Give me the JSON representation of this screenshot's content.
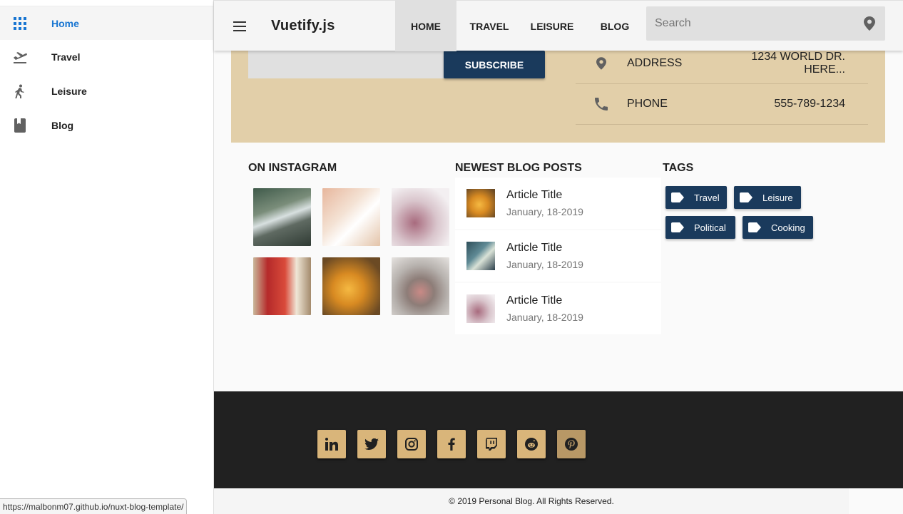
{
  "sidebar": {
    "items": [
      {
        "label": "Home",
        "icon": "apps-grid-icon",
        "active": true
      },
      {
        "label": "Travel",
        "icon": "airplane-takeoff-icon"
      },
      {
        "label": "Leisure",
        "icon": "hiker-icon"
      },
      {
        "label": "Blog",
        "icon": "book-icon"
      }
    ]
  },
  "toolbar": {
    "brand": "Vuetify.js",
    "tabs": [
      "HOME",
      "TRAVEL",
      "LEISURE",
      "BLOG"
    ],
    "active_tab": "HOME",
    "search_placeholder": "Search",
    "search_value": ""
  },
  "contact": {
    "subscribe_label": "SUBSCRIBE",
    "address_label": "ADDRESS",
    "address_value": "1234 WORLD DR. HERE...",
    "phone_label": "PHONE",
    "phone_value": "555-789-1234"
  },
  "instagram": {
    "title": "ON INSTAGRAM",
    "photos": [
      {
        "subject": "waterfall-rocks"
      },
      {
        "subject": "desk-phone"
      },
      {
        "subject": "pink-blossoms"
      },
      {
        "subject": "red-mug"
      },
      {
        "subject": "orange-spiky-plant"
      },
      {
        "subject": "cat-nose"
      }
    ]
  },
  "blog": {
    "title": "NEWEST BLOG POSTS",
    "posts": [
      {
        "title": "Article Title",
        "date": "January, 18-2019"
      },
      {
        "title": "Article Title",
        "date": "January, 18-2019"
      },
      {
        "title": "Article Title",
        "date": "January, 18-2019"
      }
    ]
  },
  "tags": {
    "title": "TAGS",
    "items": [
      "Travel",
      "Leisure",
      "Political",
      "Cooking"
    ]
  },
  "footer": {
    "social": [
      "linkedin-icon",
      "twitter-icon",
      "instagram-icon",
      "facebook-icon",
      "twitch-icon",
      "reddit-icon",
      "pinterest-icon"
    ],
    "copyright": "© 2019 Personal Blog. All Rights Reserved."
  },
  "status_bar": {
    "url": "https://malbonm07.github.io/nuxt-blog-template/"
  },
  "colors": {
    "accent_blue": "#1976d2",
    "navy": "#1a3a5c",
    "sand": "#e2cfa9",
    "gold": "#d9b57a",
    "footer_dark": "#212121"
  }
}
